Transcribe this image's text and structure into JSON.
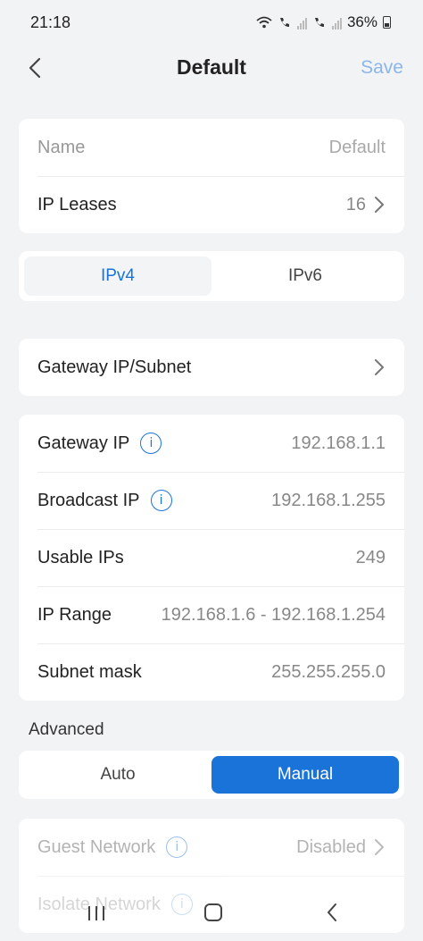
{
  "status": {
    "time": "21:18",
    "battery": "36%"
  },
  "header": {
    "title": "Default",
    "save": "Save"
  },
  "general": {
    "name_label": "Name",
    "name_value": "Default",
    "leases_label": "IP Leases",
    "leases_value": "16"
  },
  "ip_tabs": {
    "ipv4": "IPv4",
    "ipv6": "IPv6",
    "selected": "IPv4"
  },
  "gateway_subnet": {
    "label": "Gateway IP/Subnet"
  },
  "details": {
    "gateway_ip_label": "Gateway IP",
    "gateway_ip_value": "192.168.1.1",
    "broadcast_ip_label": "Broadcast IP",
    "broadcast_ip_value": "192.168.1.255",
    "usable_ips_label": "Usable IPs",
    "usable_ips_value": "249",
    "ip_range_label": "IP Range",
    "ip_range_value": "192.168.1.6 - 192.168.1.254",
    "subnet_mask_label": "Subnet mask",
    "subnet_mask_value": "255.255.255.0"
  },
  "advanced": {
    "title": "Advanced",
    "auto": "Auto",
    "manual": "Manual",
    "selected": "Manual",
    "guest_network_label": "Guest Network",
    "guest_network_value": "Disabled",
    "isolate_network_label": "Isolate Network"
  },
  "colors": {
    "accent": "#1a73d9",
    "save_disabled": "#8ab6ea",
    "background": "#f2f3f5"
  }
}
